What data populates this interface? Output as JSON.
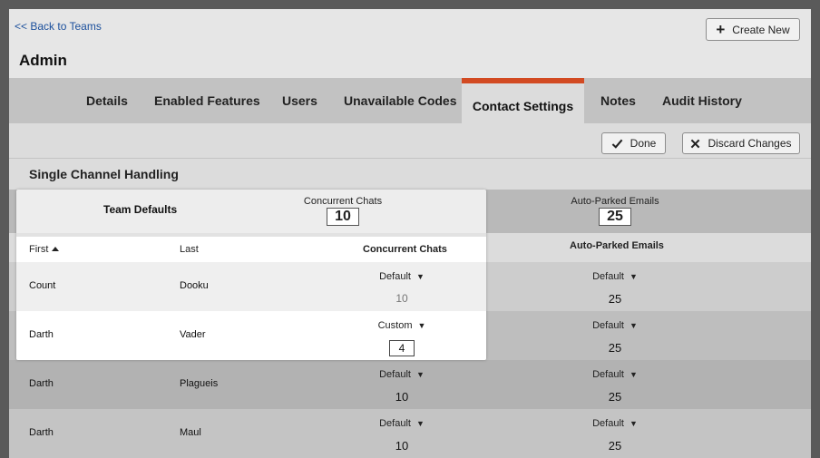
{
  "nav": {
    "back_label": "<< Back to Teams",
    "create_label": "Create New"
  },
  "page": {
    "title": "Admin"
  },
  "tabs": [
    {
      "label": "Details"
    },
    {
      "label": "Enabled Features"
    },
    {
      "label": "Users"
    },
    {
      "label": "Unavailable Codes"
    },
    {
      "label": "Contact Settings",
      "active": true
    },
    {
      "label": "Notes"
    },
    {
      "label": "Audit History"
    }
  ],
  "actions": {
    "done_label": "Done",
    "discard_label": "Discard Changes"
  },
  "section": {
    "title": "Single Channel Handling"
  },
  "team_defaults": {
    "label": "Team Defaults",
    "concurrent_label": "Concurrent Chats",
    "concurrent_value": "10",
    "parked_label": "Auto-Parked Emails",
    "parked_value": "25"
  },
  "table": {
    "headers": {
      "first": "First",
      "last": "Last",
      "concurrent": "Concurrent Chats",
      "parked": "Auto-Parked Emails"
    },
    "rows": [
      {
        "first": "Count",
        "last": "Dooku",
        "chat_mode": "Default",
        "chat_value": "10",
        "email_mode": "Default",
        "email_value": "25"
      },
      {
        "first": "Darth",
        "last": "Vader",
        "chat_mode": "Custom",
        "chat_value": "4",
        "email_mode": "Default",
        "email_value": "25"
      },
      {
        "first": "Darth",
        "last": "Plagueis",
        "chat_mode": "Default",
        "chat_value": "10",
        "email_mode": "Default",
        "email_value": "25"
      },
      {
        "first": "Darth",
        "last": "Maul",
        "chat_mode": "Default",
        "chat_value": "10",
        "email_mode": "Default",
        "email_value": "25"
      }
    ]
  },
  "colors": {
    "active_tab_accent": "#d24a22",
    "link": "#1b4f9c"
  }
}
